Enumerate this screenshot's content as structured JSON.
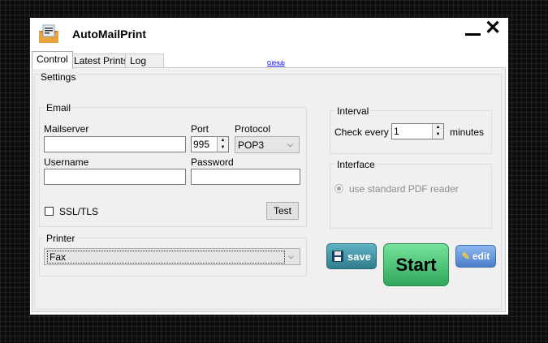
{
  "window": {
    "title": "AutoMailPrint",
    "minimize_icon": "minimize-icon",
    "close_icon": "close-icon",
    "app_icon": "mail-envelope-icon"
  },
  "tabs": [
    {
      "label": "Control",
      "active": true
    },
    {
      "label": "Latest Prints",
      "active": false
    },
    {
      "label": "Log",
      "active": false
    }
  ],
  "github_link": "GitHub",
  "settings": {
    "legend": "Settings",
    "email": {
      "legend": "Email",
      "mailserver_label": "Mailserver",
      "mailserver_value": "",
      "port_label": "Port",
      "port_value": "995",
      "protocol_label": "Protocol",
      "protocol_value": "POP3",
      "username_label": "Username",
      "username_value": "",
      "password_label": "Password",
      "password_value": "",
      "ssl_label": "SSL/TLS",
      "ssl_checked": false,
      "test_button": "Test"
    },
    "printer": {
      "legend": "Printer",
      "selected": "Fax"
    },
    "interval": {
      "legend": "Interval",
      "check_every_label": "Check every",
      "value": "1",
      "unit": "minutes"
    },
    "interface": {
      "legend": "Interface",
      "option_label": "use standard PDF reader",
      "option_selected": true,
      "enabled": false
    }
  },
  "buttons": {
    "save": "save",
    "start": "Start",
    "edit": "edit"
  },
  "colors": {
    "save_button": "#3d8e9e",
    "start_button": "#3fbf6a",
    "edit_button": "#5b8fd6"
  }
}
